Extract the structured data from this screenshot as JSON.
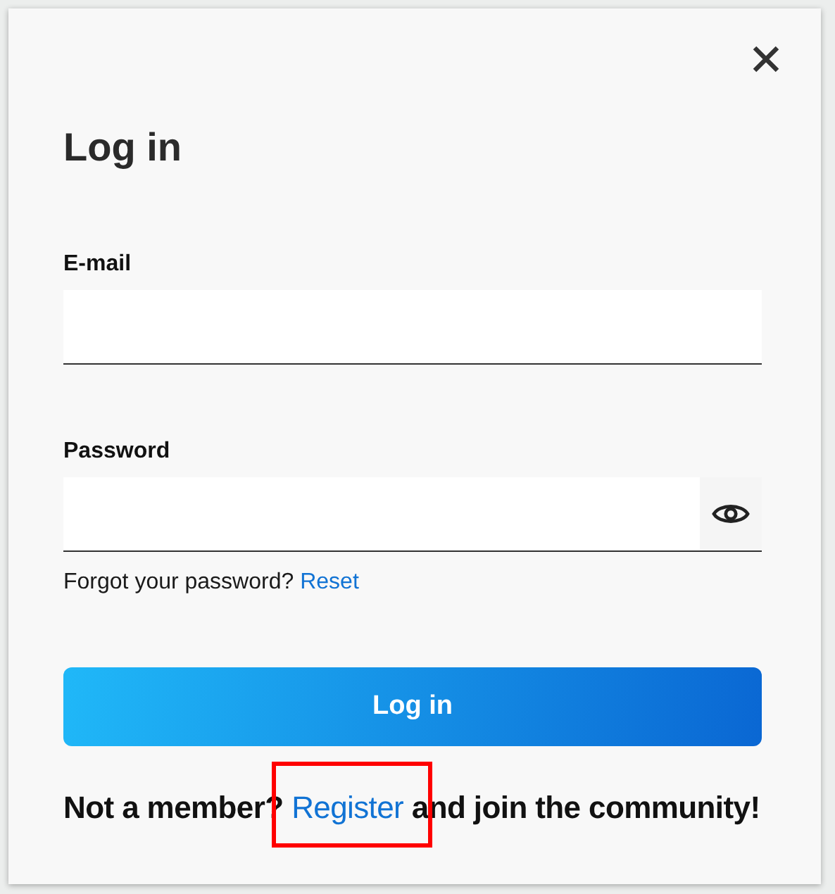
{
  "dialog": {
    "title": "Log in"
  },
  "fields": [
    {
      "label": "E-mail",
      "kind": "text"
    },
    {
      "label": "Password",
      "kind": "password"
    }
  ],
  "forgot": {
    "text": "Forgot your password?",
    "link": "Reset"
  },
  "submit": "Log in",
  "register": {
    "before": "Not a member?",
    "link": "Register",
    "after": "and join the community!",
    "highlighted": true
  }
}
